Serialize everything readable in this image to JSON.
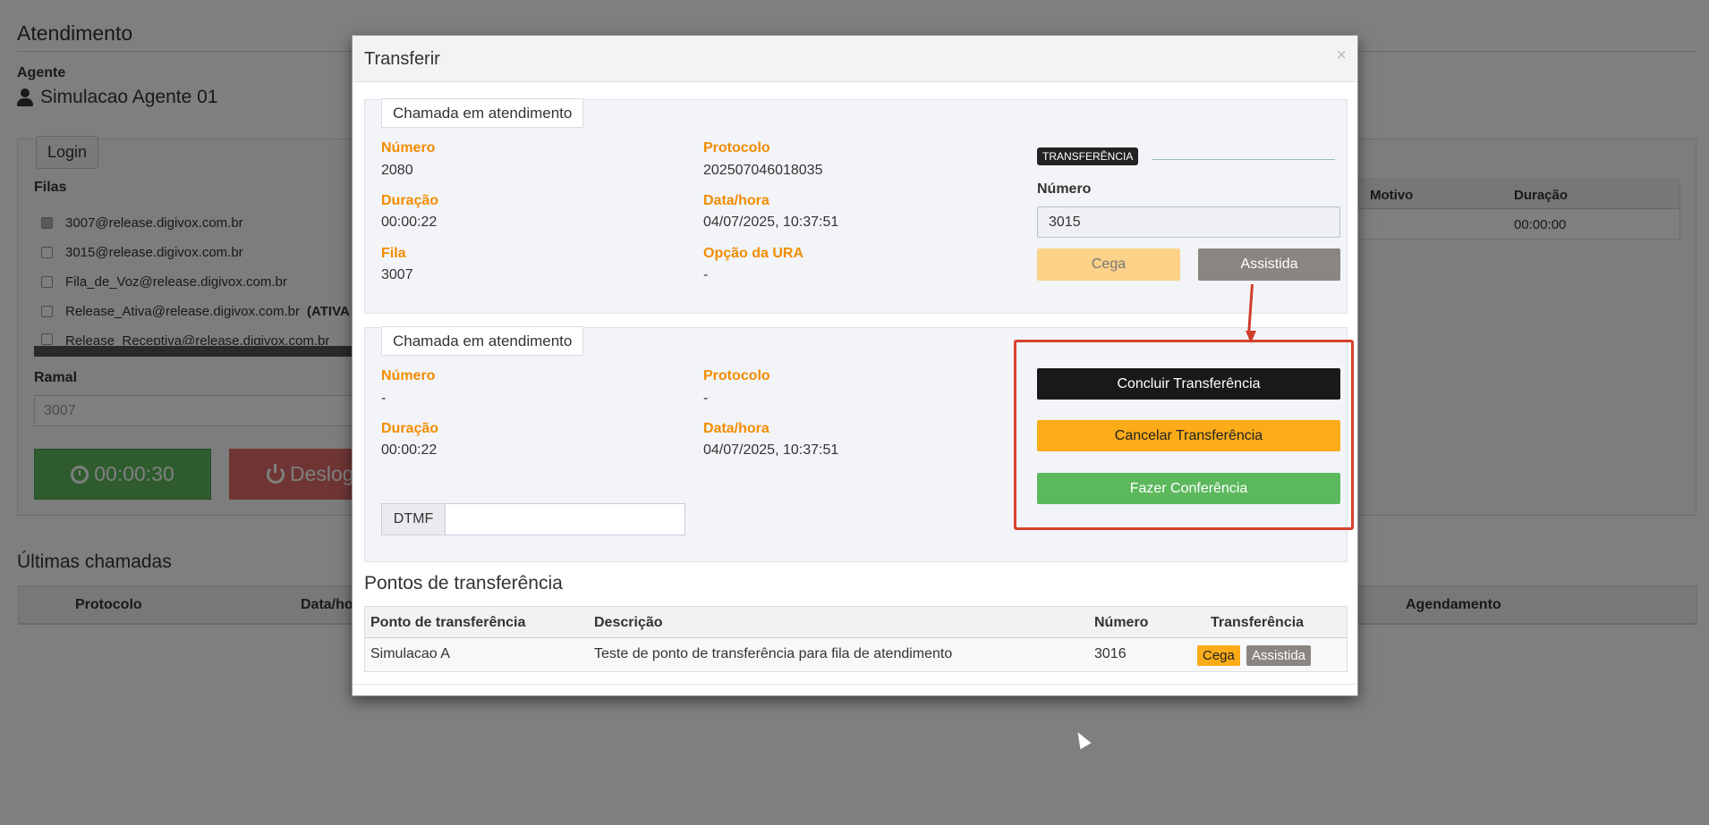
{
  "background": {
    "title": "Atendimento",
    "agent_label": "Agente",
    "agent_name": "Simulacao Agente 01",
    "login_tab": "Login",
    "filas_label": "Filas",
    "queues": [
      {
        "name": "3007@release.digivox.com.br",
        "checked": true,
        "extra": ""
      },
      {
        "name": "3015@release.digivox.com.br",
        "checked": false,
        "extra": ""
      },
      {
        "name": "Fila_de_Voz@release.digivox.com.br",
        "checked": false,
        "extra": ""
      },
      {
        "name": "Release_Ativa@release.digivox.com.br",
        "checked": false,
        "extra": "(ATIVA"
      },
      {
        "name": "Release_Receptiva@release.digivox.com.br",
        "checked": false,
        "extra": ""
      }
    ],
    "ramal_label": "Ramal",
    "ramal_value": "3007",
    "timer": "00:00:30",
    "deslogar": "Deslog",
    "right_table": {
      "headers": [
        "Motivo",
        "Duração"
      ],
      "row": [
        "",
        "00:00:00"
      ]
    },
    "ultimas_title": "Últimas chamadas",
    "ultimas_headers": [
      "Protocolo",
      "Data/ho",
      "Agendamento"
    ]
  },
  "modal": {
    "title": "Transferir",
    "close": "×",
    "call1": {
      "legend": "Chamada em atendimento",
      "numero_label": "Número",
      "numero": "2080",
      "protocolo_label": "Protocolo",
      "protocolo": "202507046018035",
      "duracao_label": "Duração",
      "duracao": "00:00:22",
      "datahora_label": "Data/hora",
      "datahora": "04/07/2025, 10:37:51",
      "fila_label": "Fila",
      "fila": "3007",
      "ura_label": "Opção da URA",
      "ura": "-"
    },
    "transfer": {
      "tag": "TRANSFERÊNCIA",
      "numero_label": "Número",
      "numero_value": "3015",
      "cega": "Cega",
      "assistida": "Assistida"
    },
    "call2": {
      "legend": "Chamada em atendimento",
      "numero_label": "Número",
      "numero": "-",
      "protocolo_label": "Protocolo",
      "protocolo": "-",
      "duracao_label": "Duração",
      "duracao": "00:00:22",
      "datahora_label": "Data/hora",
      "datahora": "04/07/2025, 10:37:51",
      "dtmf": "DTMF"
    },
    "actions": {
      "concluir": "Concluir Transferência",
      "cancelar": "Cancelar Transferência",
      "conferencia": "Fazer Conferência"
    },
    "pontos": {
      "title": "Pontos de transferência",
      "headers": [
        "Ponto de transferência",
        "Descrição",
        "Número",
        "Transferência"
      ],
      "rows": [
        {
          "ponto": "Simulacao A",
          "descricao": "Teste de ponto de transferência para fila de atendimento",
          "numero": "3016",
          "cega": "Cega",
          "assistida": "Assistida"
        }
      ]
    }
  },
  "colors": {
    "accent_orange": "#f28c00",
    "warning": "#fbac18",
    "success": "#5cb85c",
    "dark": "#1a1818",
    "highlight": "#d9412d"
  }
}
